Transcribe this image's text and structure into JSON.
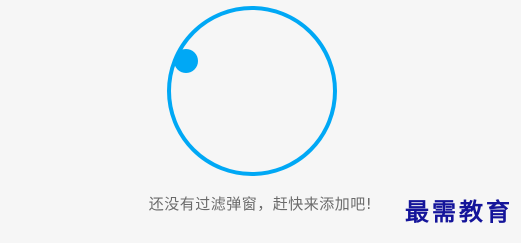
{
  "empty_state": {
    "message": "还没有过滤弹窗，赶快来添加吧!"
  },
  "watermark": {
    "text": "最需教育"
  },
  "colors": {
    "accent": "#00a8f5",
    "background": "#f6f6f6",
    "message_text": "#6b6b6b",
    "watermark_text": "#14149a"
  },
  "icons": {
    "loader": "loading-spinner-icon"
  }
}
